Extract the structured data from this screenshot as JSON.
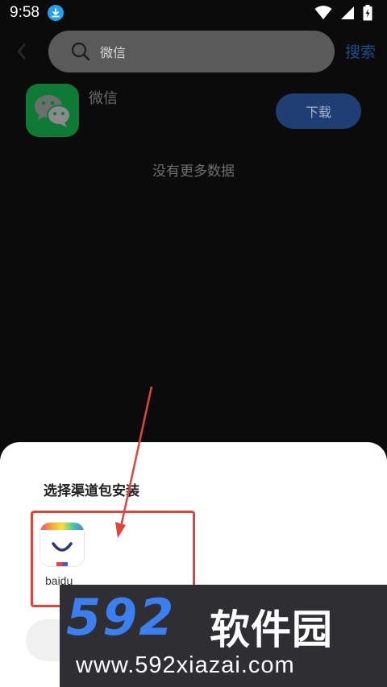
{
  "status_bar": {
    "time": "9:58",
    "icons": [
      "download-notification-icon",
      "wifi-icon",
      "signal-icon",
      "battery-charging-icon"
    ]
  },
  "top_bar": {
    "search_value": "微信",
    "search_button_label": "搜索"
  },
  "result": {
    "app_name": "微信",
    "download_label": "下载",
    "app_icon": "wechat-icon"
  },
  "list_footer": "没有更多数据",
  "sheet": {
    "title": "选择渠道包安装",
    "channels": [
      {
        "label": "baidu",
        "icon": "baidu-appstore-icon"
      }
    ]
  },
  "watermark": {
    "logo_number": "592",
    "brand": "软件园",
    "url": "www.592xiazai.com"
  },
  "colors": {
    "accent_blue": "#1e3e74",
    "annotation_red": "#e0453a",
    "wechat_green": "#0e7a36",
    "watermark_blue": "#3b7ff0"
  }
}
